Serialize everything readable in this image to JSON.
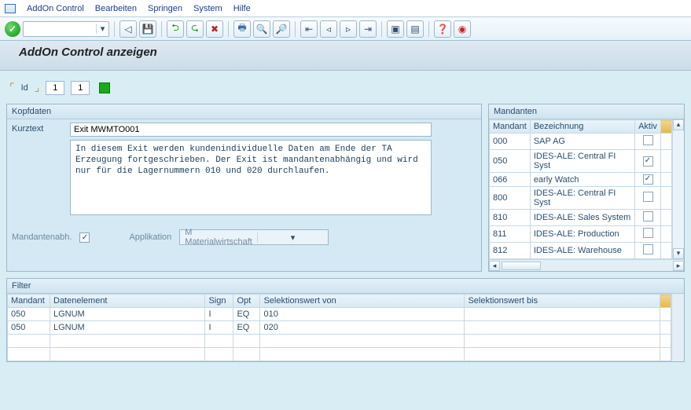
{
  "menu": {
    "items": [
      "AddOn Control",
      "Bearbeiten",
      "Springen",
      "System",
      "Hilfe"
    ]
  },
  "toolbar": {
    "check_icon": "✓",
    "icons": [
      "◁",
      "💾",
      "⮌",
      "⮎",
      "✖",
      "🖶",
      "🔍",
      "🔎",
      "📄",
      "📑",
      "📋",
      "📄",
      "🔼",
      "🔽",
      "❓",
      "⛔"
    ]
  },
  "title": "AddOn Control anzeigen",
  "idrow": {
    "label": "Id",
    "v1": "1",
    "v2": "1"
  },
  "kopf": {
    "head": "Kopfdaten",
    "kurz_label": "Kurztext",
    "kurz_value": "Exit MWMTO001",
    "longtext": "In diesem Exit werden kundenindividuelle Daten am Ende der TA Erzeugung fortgeschrieben. Der Exit ist mandantenabhängig und wird nur für die Lagernummern 010 und 020 durchlaufen.",
    "mandabh_label": "Mandantenabh.",
    "mandabh_checked": "✓",
    "app_label": "Applikation",
    "app_value": "M Materialwirtschaft"
  },
  "mand": {
    "head": "Mandanten",
    "cols": {
      "mandt": "Mandant",
      "bez": "Bezeichnung",
      "aktiv": "Aktiv"
    },
    "rows": [
      {
        "mandt": "000",
        "bez": "SAP AG",
        "aktiv": false
      },
      {
        "mandt": "050",
        "bez": "IDES-ALE: Central FI Syst",
        "aktiv": true
      },
      {
        "mandt": "066",
        "bez": "early Watch",
        "aktiv": true
      },
      {
        "mandt": "800",
        "bez": "IDES-ALE: Central FI Syst",
        "aktiv": false
      },
      {
        "mandt": "810",
        "bez": "IDES-ALE: Sales System",
        "aktiv": false
      },
      {
        "mandt": "811",
        "bez": "IDES-ALE: Production",
        "aktiv": false
      },
      {
        "mandt": "812",
        "bez": "IDES-ALE: Warehouse",
        "aktiv": false
      }
    ]
  },
  "filter": {
    "head": "Filter",
    "cols": {
      "mandt": "Mandant",
      "datel": "Datenelement",
      "sign": "Sign",
      "opt": "Opt",
      "selv": "Selektionswert von",
      "selb": "Selektionswert bis"
    },
    "rows": [
      {
        "mandt": "050",
        "datel": "LGNUM",
        "sign": "I",
        "opt": "EQ",
        "selv": "010",
        "selb": ""
      },
      {
        "mandt": "050",
        "datel": "LGNUM",
        "sign": "I",
        "opt": "EQ",
        "selv": "020",
        "selb": ""
      },
      {
        "mandt": "",
        "datel": "",
        "sign": "",
        "opt": "",
        "selv": "",
        "selb": ""
      },
      {
        "mandt": "",
        "datel": "",
        "sign": "",
        "opt": "",
        "selv": "",
        "selb": ""
      }
    ]
  }
}
